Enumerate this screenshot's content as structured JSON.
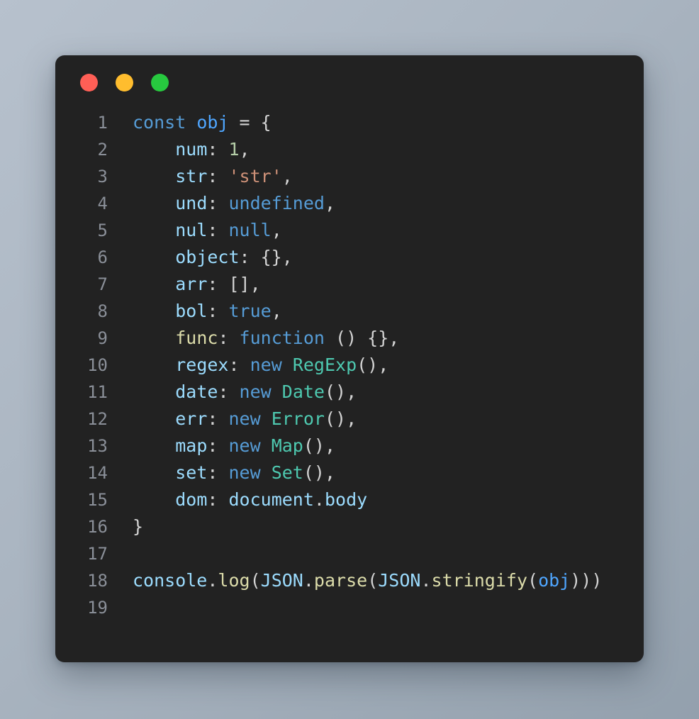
{
  "window": {
    "name": "code-editor-window",
    "background_color": "#222222",
    "page_background": "#a9b4c0",
    "traffic_lights": [
      {
        "name": "close",
        "color": "#ff5f56"
      },
      {
        "name": "minimize",
        "color": "#ffbd2e"
      },
      {
        "name": "maximize",
        "color": "#27c93f"
      }
    ]
  },
  "editor": {
    "language": "javascript",
    "theme": "dark-plus",
    "total_lines": 19,
    "colors": {
      "keyword": "#569cd6",
      "variable": "#4fa6ff",
      "property": "#9cdcfe",
      "function": "#dcdcaa",
      "class": "#4ec9b0",
      "string": "#ce9178",
      "number": "#b5cea8",
      "plain": "#d4d4d4",
      "gutter": "#8a8f98"
    },
    "lines": [
      {
        "number": "1",
        "text": "const obj = {",
        "tokens": [
          {
            "t": "const",
            "c": "tok-keyword"
          },
          {
            "t": " ",
            "c": "tok-plain"
          },
          {
            "t": "obj",
            "c": "tok-variable"
          },
          {
            "t": " = {",
            "c": "tok-plain"
          }
        ]
      },
      {
        "number": "2",
        "text": "    num: 1,",
        "tokens": [
          {
            "t": "    ",
            "c": "tok-plain"
          },
          {
            "t": "num",
            "c": "tok-property"
          },
          {
            "t": ": ",
            "c": "tok-plain"
          },
          {
            "t": "1",
            "c": "tok-number"
          },
          {
            "t": ",",
            "c": "tok-plain"
          }
        ]
      },
      {
        "number": "3",
        "text": "    str: 'str',",
        "tokens": [
          {
            "t": "    ",
            "c": "tok-plain"
          },
          {
            "t": "str",
            "c": "tok-property"
          },
          {
            "t": ": ",
            "c": "tok-plain"
          },
          {
            "t": "'str'",
            "c": "tok-string"
          },
          {
            "t": ",",
            "c": "tok-plain"
          }
        ]
      },
      {
        "number": "4",
        "text": "    und: undefined,",
        "tokens": [
          {
            "t": "    ",
            "c": "tok-plain"
          },
          {
            "t": "und",
            "c": "tok-property"
          },
          {
            "t": ": ",
            "c": "tok-plain"
          },
          {
            "t": "undefined",
            "c": "tok-keyword"
          },
          {
            "t": ",",
            "c": "tok-plain"
          }
        ]
      },
      {
        "number": "5",
        "text": "    nul: null,",
        "tokens": [
          {
            "t": "    ",
            "c": "tok-plain"
          },
          {
            "t": "nul",
            "c": "tok-property"
          },
          {
            "t": ": ",
            "c": "tok-plain"
          },
          {
            "t": "null",
            "c": "tok-keyword"
          },
          {
            "t": ",",
            "c": "tok-plain"
          }
        ]
      },
      {
        "number": "6",
        "text": "    object: {},",
        "tokens": [
          {
            "t": "    ",
            "c": "tok-plain"
          },
          {
            "t": "object",
            "c": "tok-property"
          },
          {
            "t": ": {},",
            "c": "tok-plain"
          }
        ]
      },
      {
        "number": "7",
        "text": "    arr: [],",
        "tokens": [
          {
            "t": "    ",
            "c": "tok-plain"
          },
          {
            "t": "arr",
            "c": "tok-property"
          },
          {
            "t": ": [],",
            "c": "tok-plain"
          }
        ]
      },
      {
        "number": "8",
        "text": "    bol: true,",
        "tokens": [
          {
            "t": "    ",
            "c": "tok-plain"
          },
          {
            "t": "bol",
            "c": "tok-property"
          },
          {
            "t": ": ",
            "c": "tok-plain"
          },
          {
            "t": "true",
            "c": "tok-keyword"
          },
          {
            "t": ",",
            "c": "tok-plain"
          }
        ]
      },
      {
        "number": "9",
        "text": "    func: function () {},",
        "tokens": [
          {
            "t": "    ",
            "c": "tok-plain"
          },
          {
            "t": "func",
            "c": "tok-function"
          },
          {
            "t": ": ",
            "c": "tok-plain"
          },
          {
            "t": "function",
            "c": "tok-keyword"
          },
          {
            "t": " () {},",
            "c": "tok-plain"
          }
        ]
      },
      {
        "number": "10",
        "text": "    regex: new RegExp(),",
        "tokens": [
          {
            "t": "    ",
            "c": "tok-plain"
          },
          {
            "t": "regex",
            "c": "tok-property"
          },
          {
            "t": ": ",
            "c": "tok-plain"
          },
          {
            "t": "new",
            "c": "tok-keyword"
          },
          {
            "t": " ",
            "c": "tok-plain"
          },
          {
            "t": "RegExp",
            "c": "tok-class"
          },
          {
            "t": "(),",
            "c": "tok-plain"
          }
        ]
      },
      {
        "number": "11",
        "text": "    date: new Date(),",
        "tokens": [
          {
            "t": "    ",
            "c": "tok-plain"
          },
          {
            "t": "date",
            "c": "tok-property"
          },
          {
            "t": ": ",
            "c": "tok-plain"
          },
          {
            "t": "new",
            "c": "tok-keyword"
          },
          {
            "t": " ",
            "c": "tok-plain"
          },
          {
            "t": "Date",
            "c": "tok-class"
          },
          {
            "t": "(),",
            "c": "tok-plain"
          }
        ]
      },
      {
        "number": "12",
        "text": "    err: new Error(),",
        "tokens": [
          {
            "t": "    ",
            "c": "tok-plain"
          },
          {
            "t": "err",
            "c": "tok-property"
          },
          {
            "t": ": ",
            "c": "tok-plain"
          },
          {
            "t": "new",
            "c": "tok-keyword"
          },
          {
            "t": " ",
            "c": "tok-plain"
          },
          {
            "t": "Error",
            "c": "tok-class"
          },
          {
            "t": "(),",
            "c": "tok-plain"
          }
        ]
      },
      {
        "number": "13",
        "text": "    map: new Map(),",
        "tokens": [
          {
            "t": "    ",
            "c": "tok-plain"
          },
          {
            "t": "map",
            "c": "tok-property"
          },
          {
            "t": ": ",
            "c": "tok-plain"
          },
          {
            "t": "new",
            "c": "tok-keyword"
          },
          {
            "t": " ",
            "c": "tok-plain"
          },
          {
            "t": "Map",
            "c": "tok-class"
          },
          {
            "t": "(),",
            "c": "tok-plain"
          }
        ]
      },
      {
        "number": "14",
        "text": "    set: new Set(),",
        "tokens": [
          {
            "t": "    ",
            "c": "tok-plain"
          },
          {
            "t": "set",
            "c": "tok-property"
          },
          {
            "t": ": ",
            "c": "tok-plain"
          },
          {
            "t": "new",
            "c": "tok-keyword"
          },
          {
            "t": " ",
            "c": "tok-plain"
          },
          {
            "t": "Set",
            "c": "tok-class"
          },
          {
            "t": "(),",
            "c": "tok-plain"
          }
        ]
      },
      {
        "number": "15",
        "text": "    dom: document.body",
        "tokens": [
          {
            "t": "    ",
            "c": "tok-plain"
          },
          {
            "t": "dom",
            "c": "tok-property"
          },
          {
            "t": ": ",
            "c": "tok-plain"
          },
          {
            "t": "document",
            "c": "tok-property"
          },
          {
            "t": ".",
            "c": "tok-plain"
          },
          {
            "t": "body",
            "c": "tok-property"
          }
        ]
      },
      {
        "number": "16",
        "text": "}",
        "tokens": [
          {
            "t": "}",
            "c": "tok-plain"
          }
        ]
      },
      {
        "number": "17",
        "text": "",
        "tokens": []
      },
      {
        "number": "18",
        "text": "console.log(JSON.parse(JSON.stringify(obj)))",
        "tokens": [
          {
            "t": "console",
            "c": "tok-property"
          },
          {
            "t": ".",
            "c": "tok-plain"
          },
          {
            "t": "log",
            "c": "tok-function"
          },
          {
            "t": "(",
            "c": "tok-plain"
          },
          {
            "t": "JSON",
            "c": "tok-property"
          },
          {
            "t": ".",
            "c": "tok-plain"
          },
          {
            "t": "parse",
            "c": "tok-function"
          },
          {
            "t": "(",
            "c": "tok-plain"
          },
          {
            "t": "JSON",
            "c": "tok-property"
          },
          {
            "t": ".",
            "c": "tok-plain"
          },
          {
            "t": "stringify",
            "c": "tok-function"
          },
          {
            "t": "(",
            "c": "tok-plain"
          },
          {
            "t": "obj",
            "c": "tok-variable"
          },
          {
            "t": ")))",
            "c": "tok-plain"
          }
        ]
      },
      {
        "number": "19",
        "text": "",
        "tokens": []
      }
    ]
  }
}
